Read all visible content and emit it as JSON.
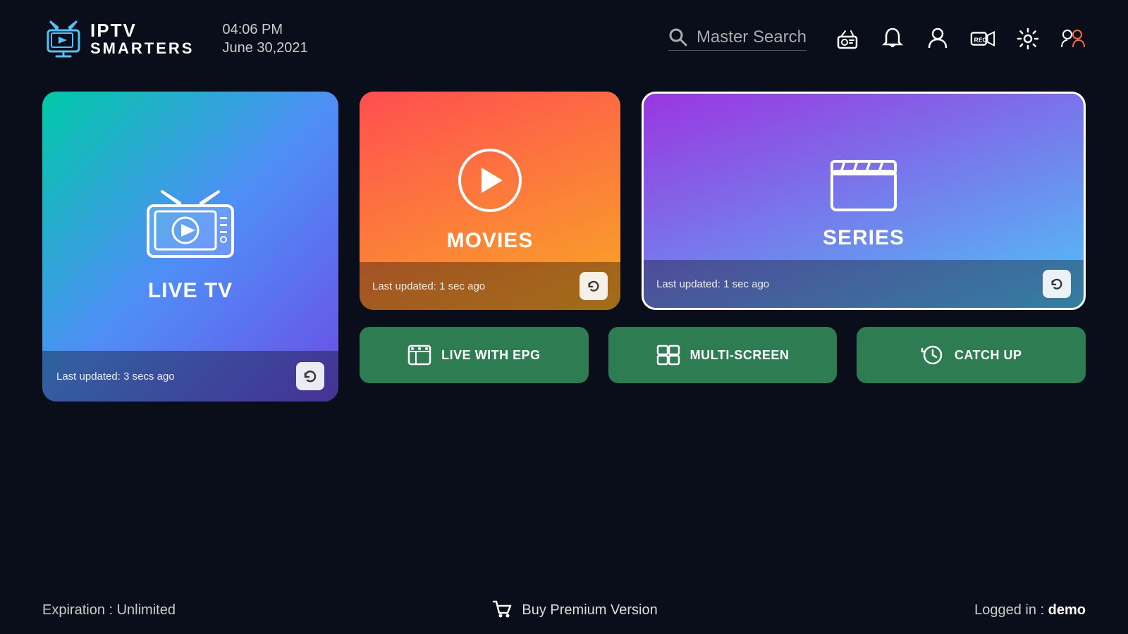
{
  "header": {
    "logo_iptv": "IPTV",
    "logo_smarters": "SMARTERS",
    "time": "04:06 PM",
    "date": "June 30,2021",
    "search_placeholder": "Master Search"
  },
  "nav_icons": {
    "radio": "📻",
    "bell": "🔔",
    "user": "👤",
    "record": "📹",
    "settings": "⚙",
    "account_switch": "👥"
  },
  "cards": {
    "live_tv": {
      "label": "LIVE TV",
      "last_updated": "Last updated: 3 secs ago"
    },
    "movies": {
      "label": "MOVIES",
      "last_updated": "Last updated: 1 sec ago"
    },
    "series": {
      "label": "SERIES",
      "last_updated": "Last updated: 1 sec ago"
    }
  },
  "buttons": {
    "live_epg": "LIVE WITH EPG",
    "multi_screen": "MULTI-SCREEN",
    "catch_up": "CATCH UP"
  },
  "footer": {
    "expiration": "Expiration : Unlimited",
    "buy_premium": "Buy Premium Version",
    "logged_in_label": "Logged in : ",
    "logged_in_user": "demo"
  }
}
